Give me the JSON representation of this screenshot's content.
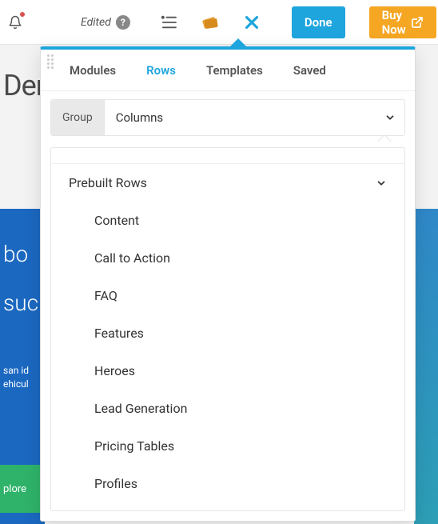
{
  "topbar": {
    "edited_label": "Edited",
    "help_symbol": "?",
    "done_label": "Done",
    "buy_label": "Buy Now"
  },
  "panel": {
    "tabs": {
      "modules": "Modules",
      "rows": "Rows",
      "templates": "Templates",
      "saved": "Saved"
    },
    "segments": {
      "group": "Group",
      "columns": "Columns"
    },
    "dropdown": {
      "header": "Prebuilt Rows",
      "items": [
        "Content",
        "Call to Action",
        "FAQ",
        "Features",
        "Heroes",
        "Lead Generation",
        "Pricing Tables",
        "Profiles"
      ]
    }
  },
  "page_bg": {
    "title": "Der",
    "blue_words": {
      "a": "bo",
      "b": "suc",
      "c": "san id",
      "d": "ehicul"
    },
    "green_btn": "plore"
  }
}
